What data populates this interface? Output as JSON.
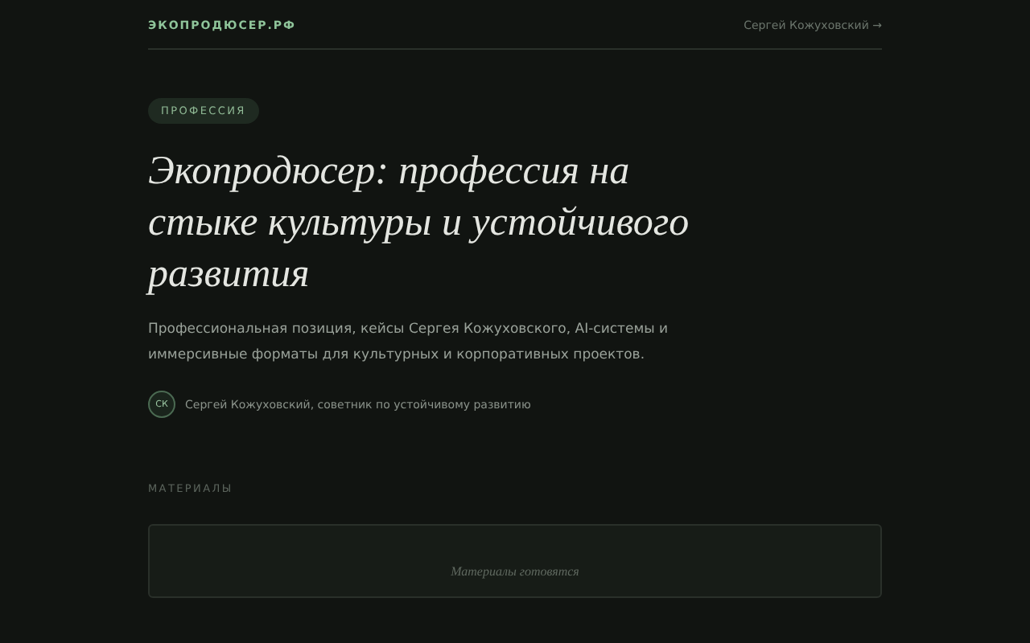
{
  "header": {
    "logo": "ЭКОПРОДЮСЕР.РФ",
    "author_link": "Сергей Кожуховский →"
  },
  "hero": {
    "badge": "ПРОФЕССИЯ",
    "title": "Экопродюсер: профессия на стыке культуры и устойчивого развития",
    "lead": "Профессиональная позиция, кейсы Сергея Кожуховского, AI-системы и иммерсивные форматы для культурных и корпоративных проектов.",
    "author": {
      "initials": "СК",
      "caption": "Сергей Кожуховский, советник по устойчивому развитию"
    }
  },
  "materials": {
    "label": "МАТЕРИАЛЫ",
    "placeholder": "Материалы готовятся"
  }
}
